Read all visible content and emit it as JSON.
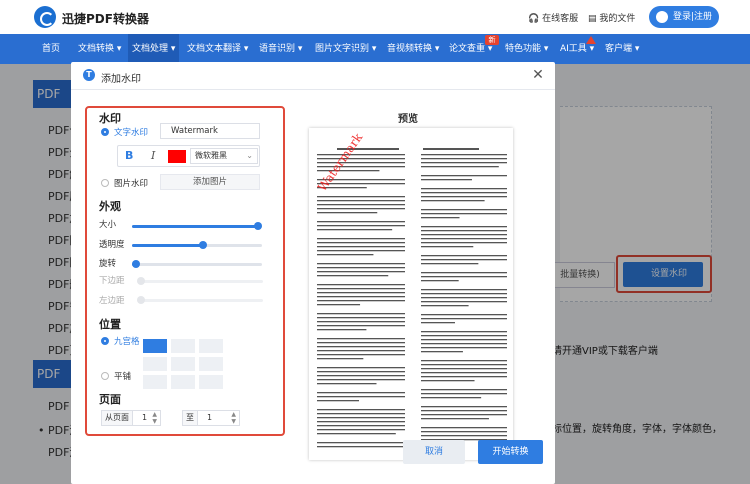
{
  "header": {
    "brand": "迅捷PDF转换器",
    "service": "在线客服",
    "my_files": "我的文件",
    "login": "登录|注册"
  },
  "nav": {
    "items": [
      "首页",
      "文档转换 ▾",
      "文档处理 ▾",
      "文档文本翻译 ▾",
      "语音识别 ▾",
      "图片文字识别 ▾",
      "音视频转换 ▾",
      "论文查重 ▾",
      "特色功能 ▾",
      "AI工具 ▾",
      "客户端 ▾"
    ],
    "hot_badge": "新"
  },
  "background": {
    "side_block1": "PDF",
    "side_block2": "PDF",
    "side_items": [
      "PDF合",
      "PDF分",
      "PDF解",
      "PDF压",
      "PDF加",
      "PDF图",
      "PDF图",
      "PDF删",
      "PDF替",
      "PDF旋",
      "PDF页",
      "PDF",
      "• PDF添",
      "PDF添"
    ],
    "batch_btn": "批量转换)",
    "set_wm_btn": "设置水印",
    "text_vip": "请开通VIP或下载客户端",
    "text_desc": "标位置，旋转角度，字体，字体颜色，"
  },
  "modal": {
    "title": "添加水印",
    "settings": {
      "section_watermark": "水印",
      "text_wm_label": "文字水印",
      "text_wm_value": "Watermark",
      "bold": "B",
      "italic": "I",
      "font": "微软雅黑",
      "color": "#ff0000",
      "image_wm_label": "图片水印",
      "add_image": "添加图片",
      "section_appearance": "外观",
      "size_label": "大小",
      "opacity_label": "透明度",
      "rotation_label": "旋转",
      "bottom_margin_label": "下边距",
      "left_margin_label": "左边距",
      "size_level": 1.0,
      "opacity_level": 0.55,
      "rotation_level": 0.0,
      "section_position": "位置",
      "ninegrid_label": "九宫格",
      "tile_label": "平铺",
      "section_pages": "页面",
      "from_page_label": "从页面",
      "from_page_value": "1",
      "to_page_label": "至",
      "to_page_value": "1"
    },
    "preview": {
      "title": "预览",
      "watermark_text": "Watermark"
    },
    "buttons": {
      "cancel": "取消",
      "start": "开始转换"
    }
  }
}
